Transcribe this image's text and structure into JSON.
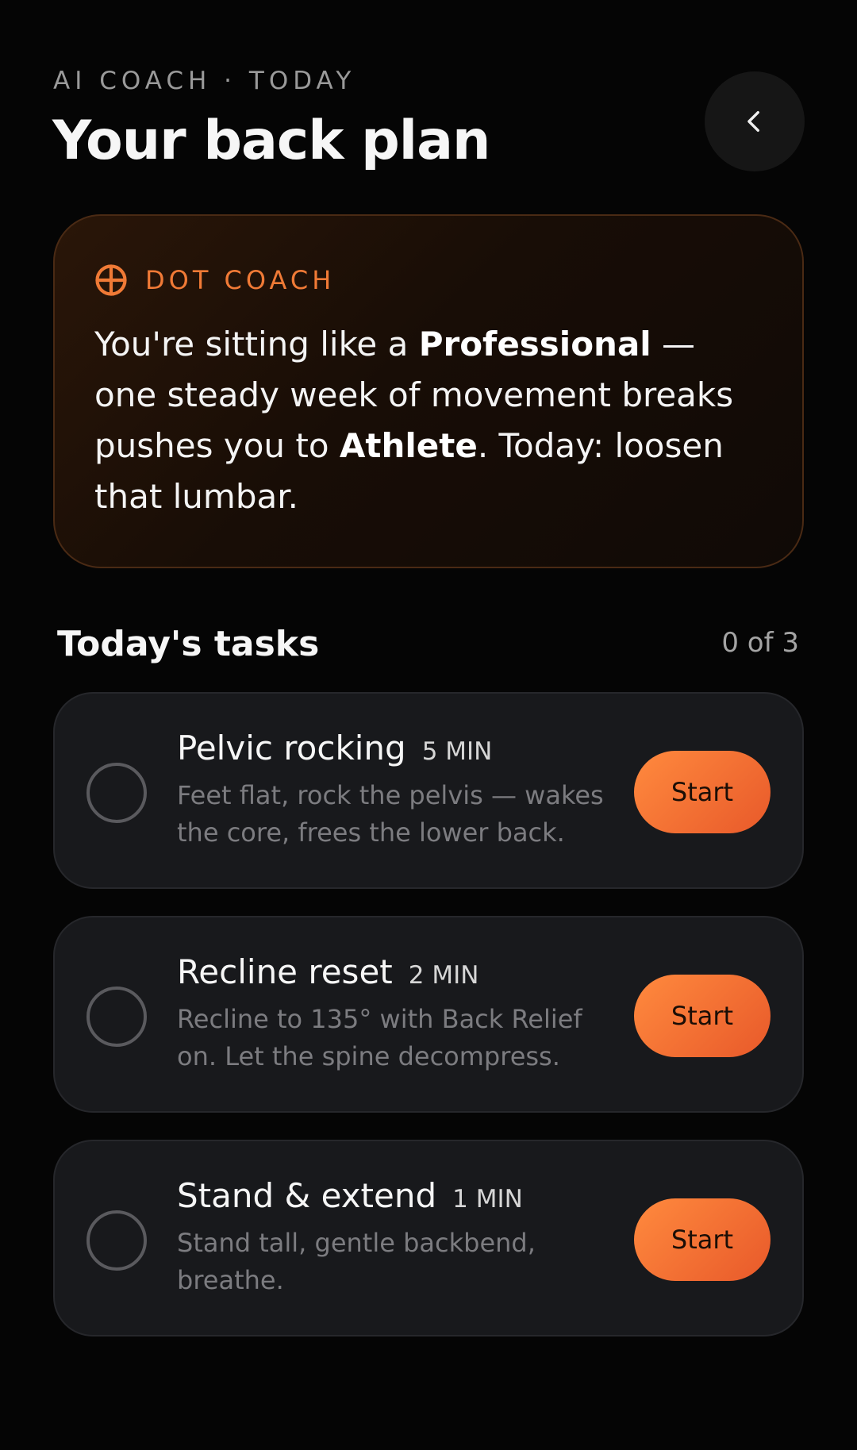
{
  "header": {
    "eyebrow": "AI COACH · TODAY",
    "title": "Your back plan",
    "back_icon": "chevron-left-icon"
  },
  "coach": {
    "icon": "crosshair-circle-icon",
    "label": "DOT COACH",
    "message_part1": "You're sitting like a ",
    "message_bold1": "Professional",
    "message_part2": " — one steady week of movement breaks pushes you to ",
    "message_bold2": "Athlete",
    "message_part3": ". Today: loosen that lumbar."
  },
  "tasks": {
    "title": "Today's tasks",
    "count": "0 of 3",
    "items": [
      {
        "title": "Pelvic rocking",
        "duration": "5 MIN",
        "description": "Feet flat, rock the pelvis — wakes the core, frees the lower back.",
        "button_label": "Start",
        "completed": false
      },
      {
        "title": "Recline reset",
        "duration": "2 MIN",
        "description": "Recline to 135° with Back Relief on. Let the spine decompress.",
        "button_label": "Start",
        "completed": false
      },
      {
        "title": "Stand & extend",
        "duration": "1 MIN",
        "description": "Stand tall, gentle backbend, breathe.",
        "button_label": "Start",
        "completed": false
      }
    ]
  },
  "colors": {
    "accent": "#f07a36",
    "button_gradient_start": "#ff8a3e",
    "button_gradient_end": "#e8592a",
    "background": "#050505",
    "card": "#18191c"
  }
}
